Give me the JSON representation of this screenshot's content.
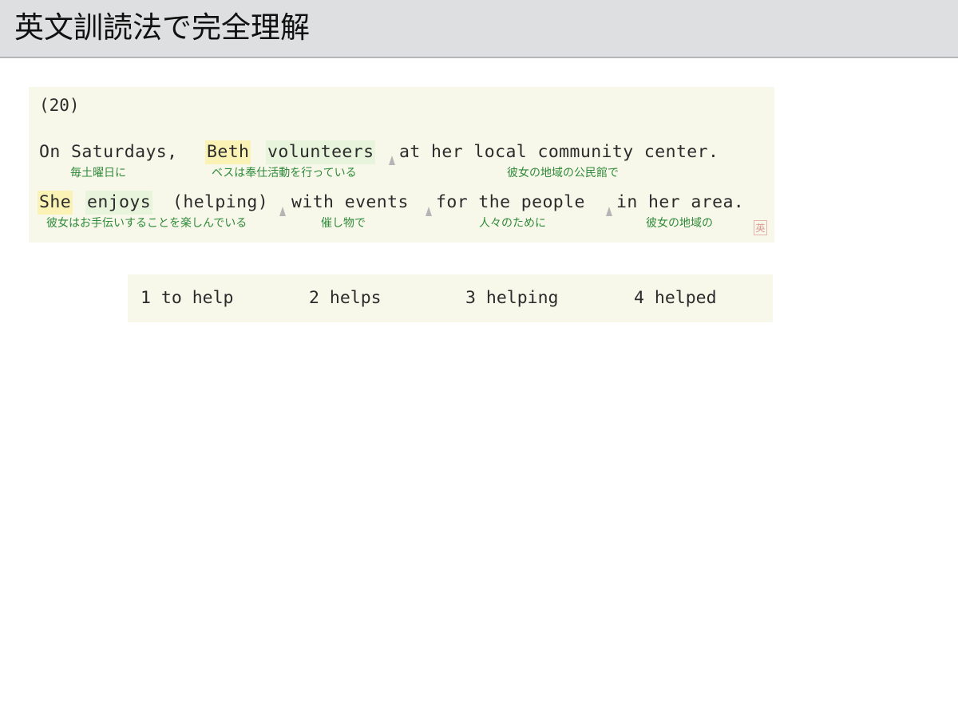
{
  "header": {
    "title": "英文訓読法で完全理解"
  },
  "question": {
    "number": "(20)",
    "line1": {
      "words": [
        "On Saturdays,",
        "Beth",
        "volunteers",
        "at her local community center."
      ],
      "glosses": [
        "毎土曜日に",
        "ベスは奉仕活動を行っている",
        "彼女の地域の公民館で"
      ]
    },
    "line2": {
      "words": [
        "She",
        "enjoys",
        "(helping)",
        "with events",
        "for the people",
        "in her area."
      ],
      "glosses": [
        "彼女はお手伝いすることを楽しんでいる",
        "催し物で",
        "人々のために",
        "彼女の地域の"
      ]
    },
    "stamp": "英"
  },
  "choices": [
    "1 to help",
    "2 helps",
    "3 helping",
    "4 helped"
  ],
  "colors": {
    "highlight_subject": "#fbf3b5",
    "highlight_verb": "#e8f4dc",
    "gloss_text": "#2f8a3a",
    "panel_bg": "#f8f8ea",
    "header_bg": "#dedfe1"
  }
}
